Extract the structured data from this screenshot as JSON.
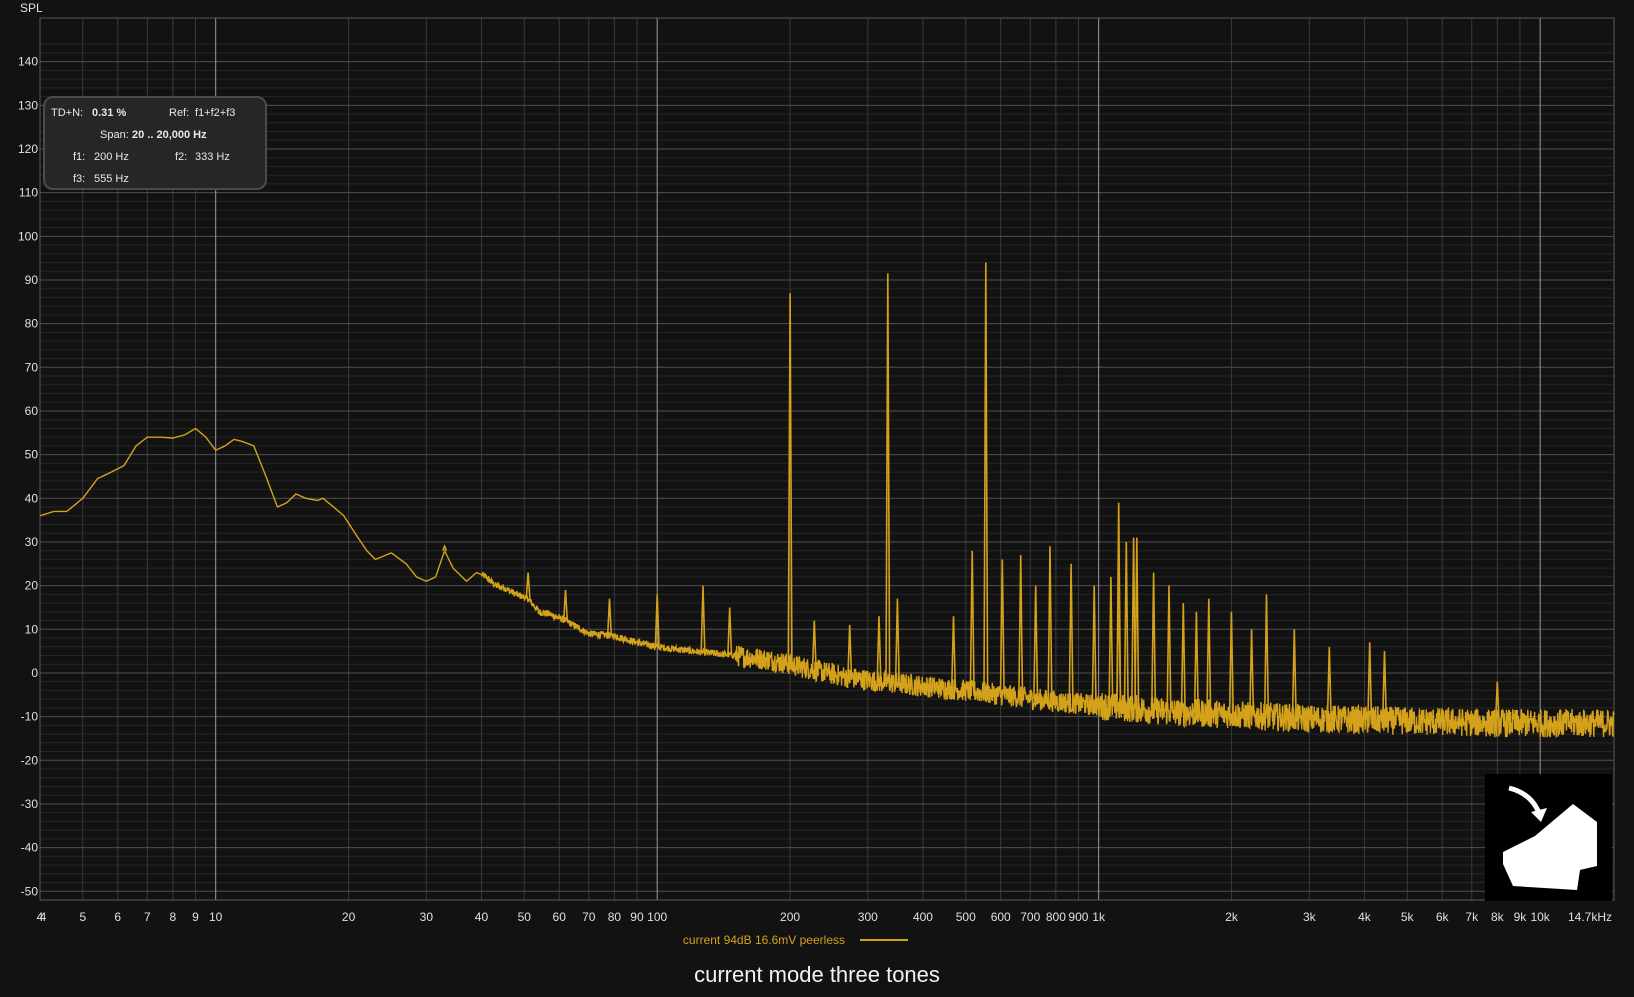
{
  "colors": {
    "background": "#121212",
    "trace": "#d4a21a",
    "grid_major": "#6a6a6a",
    "grid_minor": "#2e2e2e"
  },
  "info": {
    "thdn_label": "TD+N:",
    "thdn_value": "0.31 %",
    "ref_label": "Ref:",
    "ref_value": "f1+f2+f3",
    "span_label": "Span:",
    "span_value": "20 .. 20,000 Hz",
    "f1_label": "f1:",
    "f1_value": "200 Hz",
    "f2_label": "f2:",
    "f2_value": "333 Hz",
    "f3_label": "f3:",
    "f3_value": "555 Hz"
  },
  "caption": "current mode three tones",
  "logo_icon": "house-with-arrow-icon",
  "chart_data": {
    "type": "line",
    "title": "",
    "ylabel": "SPL",
    "xlabel": "",
    "x_scale": "log",
    "xlim": [
      4,
      14700
    ],
    "ylim": [
      -50,
      150
    ],
    "grid": true,
    "y_ticks": [
      140,
      130,
      120,
      110,
      100,
      90,
      80,
      70,
      60,
      50,
      40,
      30,
      20,
      10,
      0,
      -10,
      -20,
      -30,
      -40,
      -50
    ],
    "x_ticks": [
      {
        "v": 4,
        "label": "4"
      },
      {
        "v": 5,
        "label": "5"
      },
      {
        "v": 6,
        "label": "6"
      },
      {
        "v": 7,
        "label": "7"
      },
      {
        "v": 8,
        "label": "8"
      },
      {
        "v": 9,
        "label": "9"
      },
      {
        "v": 10,
        "label": "10"
      },
      {
        "v": 20,
        "label": "20"
      },
      {
        "v": 30,
        "label": "30"
      },
      {
        "v": 40,
        "label": "40"
      },
      {
        "v": 50,
        "label": "50"
      },
      {
        "v": 60,
        "label": "60"
      },
      {
        "v": 70,
        "label": "70"
      },
      {
        "v": 80,
        "label": "80"
      },
      {
        "v": 90,
        "label": "90"
      },
      {
        "v": 100,
        "label": "100"
      },
      {
        "v": 200,
        "label": "200"
      },
      {
        "v": 300,
        "label": "300"
      },
      {
        "v": 400,
        "label": "400"
      },
      {
        "v": 500,
        "label": "500"
      },
      {
        "v": 600,
        "label": "600"
      },
      {
        "v": 700,
        "label": "700"
      },
      {
        "v": 800,
        "label": "800"
      },
      {
        "v": 900,
        "label": "900"
      },
      {
        "v": 1000,
        "label": "1k"
      },
      {
        "v": 2000,
        "label": "2k"
      },
      {
        "v": 3000,
        "label": "3k"
      },
      {
        "v": 4000,
        "label": "4k"
      },
      {
        "v": 5000,
        "label": "5k"
      },
      {
        "v": 6000,
        "label": "6k"
      },
      {
        "v": 7000,
        "label": "7k"
      },
      {
        "v": 8000,
        "label": "8k"
      },
      {
        "v": 9000,
        "label": "9k"
      },
      {
        "v": 10000,
        "label": "10k"
      },
      {
        "v": 14700,
        "label": "14.7kHz"
      }
    ],
    "series": [
      {
        "name": "current 94dB 16.6mV peerless",
        "baseline": [
          [
            4,
            36
          ],
          [
            4.3,
            37
          ],
          [
            4.6,
            37
          ],
          [
            5,
            40
          ],
          [
            5.4,
            44.5
          ],
          [
            5.8,
            46
          ],
          [
            6.2,
            47.5
          ],
          [
            6.6,
            52
          ],
          [
            7,
            54
          ],
          [
            7.5,
            54
          ],
          [
            8,
            53.8
          ],
          [
            8.5,
            54.5
          ],
          [
            9,
            56
          ],
          [
            9.5,
            54
          ],
          [
            10,
            51
          ],
          [
            10.5,
            52
          ],
          [
            11,
            53.5
          ],
          [
            11.5,
            53
          ],
          [
            12.2,
            52
          ],
          [
            13,
            45
          ],
          [
            13.8,
            38
          ],
          [
            14.5,
            39
          ],
          [
            15.2,
            41
          ],
          [
            16,
            40
          ],
          [
            17,
            39.5
          ],
          [
            17.5,
            40
          ],
          [
            18.5,
            38
          ],
          [
            19.5,
            36
          ],
          [
            21,
            31
          ],
          [
            22,
            28
          ],
          [
            23,
            26
          ],
          [
            25,
            27.5
          ],
          [
            27,
            25
          ],
          [
            28.5,
            22
          ],
          [
            30,
            21
          ],
          [
            31.5,
            22
          ],
          [
            33,
            28
          ],
          [
            34.5,
            24
          ],
          [
            37,
            21
          ],
          [
            39,
            23
          ],
          [
            41,
            22
          ],
          [
            43,
            20
          ],
          [
            45,
            19.5
          ],
          [
            48,
            18
          ],
          [
            51,
            17
          ],
          [
            54,
            14
          ],
          [
            57,
            13.5
          ],
          [
            62,
            12
          ],
          [
            70,
            9
          ],
          [
            80,
            8.5
          ],
          [
            90,
            7
          ],
          [
            100,
            6
          ],
          [
            120,
            5
          ],
          [
            150,
            4
          ],
          [
            180,
            3
          ],
          [
            220,
            1
          ],
          [
            270,
            -1
          ],
          [
            320,
            -2
          ],
          [
            400,
            -3
          ],
          [
            500,
            -4
          ],
          [
            600,
            -5
          ],
          [
            800,
            -6.5
          ],
          [
            1000,
            -7.5
          ],
          [
            1500,
            -9
          ],
          [
            2000,
            -9.5
          ],
          [
            3000,
            -10.5
          ],
          [
            5000,
            -11
          ],
          [
            8000,
            -11.5
          ],
          [
            14700,
            -11.5
          ]
        ],
        "noise_amplitude_db": 2.5,
        "peaks": [
          [
            200,
            87
          ],
          [
            333,
            91.5
          ],
          [
            555,
            94
          ],
          [
            1110,
            39
          ],
          [
            1155,
            30
          ],
          [
            1220,
            31
          ],
          [
            1443,
            20
          ],
          [
            2400,
            18
          ],
          [
            4110,
            7
          ],
          [
            33,
            29
          ],
          [
            51,
            23
          ],
          [
            62,
            19
          ],
          [
            78,
            17
          ],
          [
            100,
            18
          ],
          [
            127,
            20
          ],
          [
            146,
            15
          ],
          [
            227,
            12
          ],
          [
            273,
            11
          ],
          [
            318,
            13
          ],
          [
            350,
            17
          ],
          [
            469,
            13
          ],
          [
            517,
            28
          ],
          [
            605,
            26
          ],
          [
            666,
            27
          ],
          [
            720,
            20
          ],
          [
            776,
            29
          ],
          [
            866,
            25
          ],
          [
            977,
            20
          ],
          [
            1066,
            22
          ],
          [
            1110,
            22
          ],
          [
            1200,
            31
          ],
          [
            1332,
            23
          ],
          [
            1555,
            16
          ],
          [
            1665,
            14
          ],
          [
            1776,
            17
          ],
          [
            1998,
            14
          ],
          [
            2220,
            10
          ],
          [
            2775,
            10
          ],
          [
            3330,
            6
          ],
          [
            4440,
            5
          ],
          [
            8000,
            -2
          ]
        ]
      }
    ]
  }
}
